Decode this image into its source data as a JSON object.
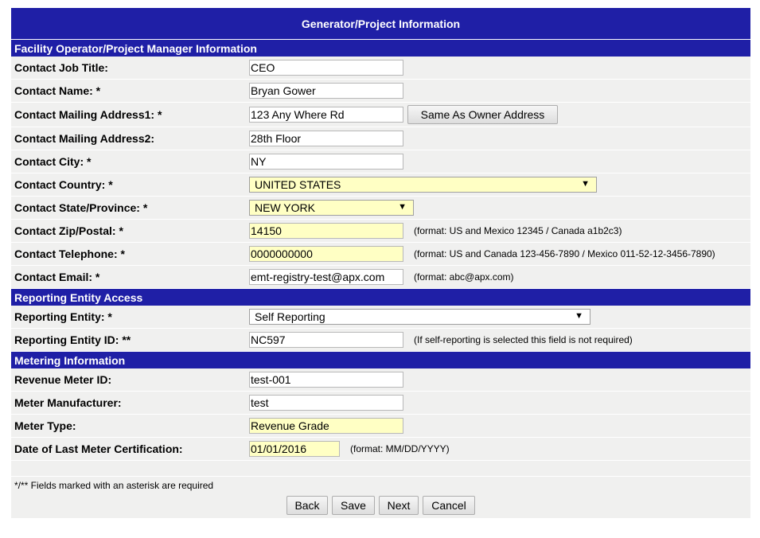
{
  "title": "Generator/Project Information",
  "sections": {
    "facility": "Facility Operator/Project Manager Information",
    "reporting": "Reporting Entity Access",
    "metering": "Metering Information"
  },
  "fields": {
    "job_title": {
      "label": "Contact Job Title:",
      "value": "CEO"
    },
    "name": {
      "label": "Contact Name: *",
      "value": "Bryan Gower"
    },
    "address1": {
      "label": "Contact Mailing Address1: *",
      "value": "123 Any Where Rd"
    },
    "address2": {
      "label": "Contact Mailing Address2:",
      "value": "28th Floor"
    },
    "city": {
      "label": "Contact City: *",
      "value": "NY"
    },
    "country": {
      "label": "Contact Country: *",
      "value": "UNITED STATES"
    },
    "state": {
      "label": "Contact State/Province: *",
      "value": "NEW YORK"
    },
    "zip": {
      "label": "Contact Zip/Postal: *",
      "value": "14150",
      "hint": "(format: US and Mexico 12345 / Canada a1b2c3)"
    },
    "phone": {
      "label": "Contact Telephone: *",
      "value": "0000000000",
      "hint": "(format: US and Canada 123-456-7890 / Mexico 011-52-12-3456-7890)"
    },
    "email": {
      "label": "Contact Email: *",
      "value": "emt-registry-test@apx.com",
      "hint": "(format: abc@apx.com)"
    },
    "reporting_entity": {
      "label": "Reporting Entity: *",
      "value": "Self Reporting"
    },
    "reporting_entity_id": {
      "label": "Reporting Entity ID: **",
      "value": "NC597",
      "hint": "(If self-reporting is selected this field is not required)"
    },
    "meter_id": {
      "label": "Revenue Meter ID:",
      "value": "test-001"
    },
    "meter_manufacturer": {
      "label": "Meter Manufacturer:",
      "value": "test"
    },
    "meter_type": {
      "label": "Meter Type:",
      "value": "Revenue Grade"
    },
    "cert_date": {
      "label": "Date of Last Meter Certification:",
      "value": "01/01/2016",
      "hint": "(format: MM/DD/YYYY)"
    }
  },
  "same_as_owner_label": "Same As Owner Address",
  "required_note": "*/** Fields marked with an asterisk are required",
  "buttons": {
    "back": "Back",
    "save": "Save",
    "next": "Next",
    "cancel": "Cancel"
  },
  "colors": {
    "header": "#1f1fa6",
    "required_field": "#ffffc4",
    "row_bg": "#f0f0ef"
  }
}
